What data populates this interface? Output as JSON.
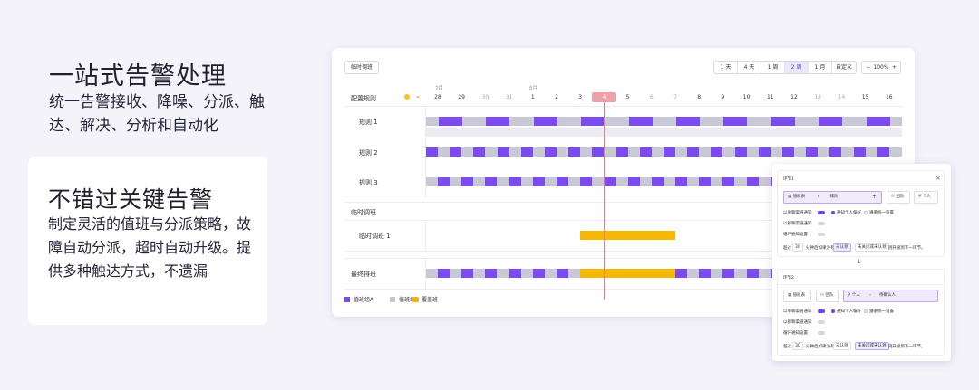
{
  "left": {
    "headline1": "一站式告警处理",
    "sub1": "统一告警接收、降噪、分派、触达、解决、分析和自动化",
    "headline2": "不错过关键告警",
    "sub2": "制定灵活的值班与分派策略，故障自动分派，超时自动升级。提供多种触达方式，不遗漏"
  },
  "schedule": {
    "temp_shift_button": "临时调班",
    "ranges": [
      "1 天",
      "4 天",
      "1 周",
      "2 周",
      "1 月",
      "自定义"
    ],
    "active_range": "2 周",
    "zoom": {
      "minus": "−",
      "value": "100%",
      "plus": "+"
    },
    "months": [
      "7月",
      "8月"
    ],
    "days": [
      "28",
      "29",
      "30",
      "31",
      "1",
      "2",
      "3",
      "4",
      "5",
      "6",
      "7",
      "8",
      "9",
      "10",
      "11",
      "12",
      "13",
      "14",
      "15",
      "16"
    ],
    "weekend_days": [
      "30",
      "31",
      "6",
      "7",
      "13",
      "14"
    ],
    "today": "4",
    "config_header": "配置规则",
    "rules": [
      "规则 1",
      "规则 2",
      "规则 3"
    ],
    "temp_section": "临时调班",
    "temp_rows": [
      "临时调班 1"
    ],
    "final_section": "最终排班",
    "legend": [
      {
        "label": "值班组A",
        "color": "#7b4bf0"
      },
      {
        "label": "值班组B",
        "color": "#c9c8d6"
      },
      {
        "label": "覆盖班",
        "color": "#f5b800"
      }
    ]
  },
  "panel": {
    "node1_title": "环节1",
    "close": "×",
    "node1_path": {
      "from": "值班表",
      "to": "排队"
    },
    "node1_options": [
      "团队",
      "个人"
    ],
    "notify_label": "以单聊渠道通知",
    "radio_on": "通知个人偏好",
    "radio_off": "遵循统一设置",
    "notify_label2": "以群聊渠道通知",
    "repeat_label": "循环通知设置",
    "timeout_prefix": "超过",
    "timeout_value": "30",
    "timeout_unit": "分钟后如果没有",
    "timeout_box1": "未认领",
    "timeout_box2": "未关闭或未认领",
    "timeout_suffix": "则升级到下一环节。",
    "arrow": "↓",
    "node2_title": "环节2",
    "node2_options": [
      "值班表",
      "团队"
    ],
    "node2_path": {
      "from": "个人",
      "to": "待确认人"
    }
  }
}
